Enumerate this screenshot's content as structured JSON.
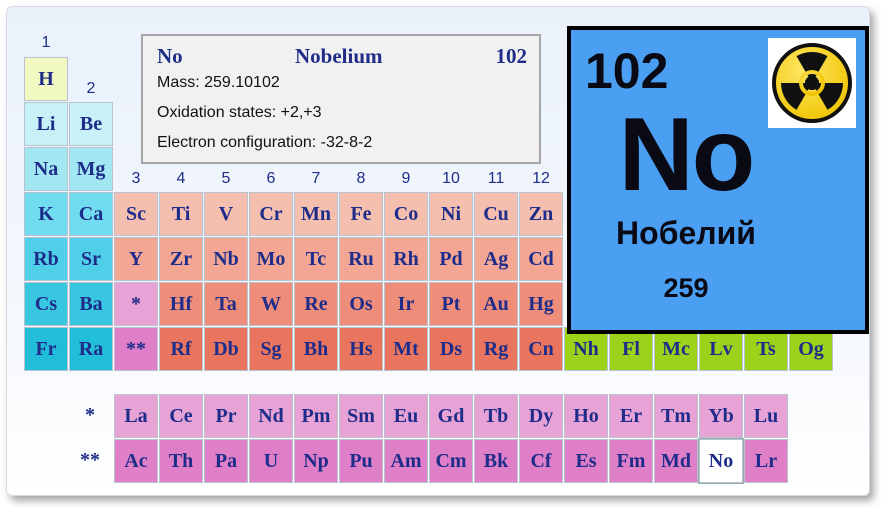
{
  "group_numbers": [
    "1",
    "2",
    "3",
    "4",
    "5",
    "6",
    "7",
    "8",
    "9",
    "10",
    "11",
    "12"
  ],
  "periodic_table": [
    {
      "symbol": "H",
      "row": 0,
      "col": 0,
      "color": "#f1f8c0"
    },
    {
      "symbol": "Li",
      "row": 1,
      "col": 0,
      "color": "#c8f1f7"
    },
    {
      "symbol": "Be",
      "row": 1,
      "col": 1,
      "color": "#c8f1f7"
    },
    {
      "symbol": "Na",
      "row": 2,
      "col": 0,
      "color": "#a3e7f3"
    },
    {
      "symbol": "Mg",
      "row": 2,
      "col": 1,
      "color": "#a3e7f3"
    },
    {
      "symbol": "K",
      "row": 3,
      "col": 0,
      "color": "#71dcef"
    },
    {
      "symbol": "Ca",
      "row": 3,
      "col": 1,
      "color": "#71dcef"
    },
    {
      "symbol": "Sc",
      "row": 3,
      "col": 2,
      "color": "#f5bfb0"
    },
    {
      "symbol": "Ti",
      "row": 3,
      "col": 3,
      "color": "#f5bfb0"
    },
    {
      "symbol": "V",
      "row": 3,
      "col": 4,
      "color": "#f5bfb0"
    },
    {
      "symbol": "Cr",
      "row": 3,
      "col": 5,
      "color": "#f5bfb0"
    },
    {
      "symbol": "Mn",
      "row": 3,
      "col": 6,
      "color": "#f5bfb0"
    },
    {
      "symbol": "Fe",
      "row": 3,
      "col": 7,
      "color": "#f5bfb0"
    },
    {
      "symbol": "Co",
      "row": 3,
      "col": 8,
      "color": "#f5bfb0"
    },
    {
      "symbol": "Ni",
      "row": 3,
      "col": 9,
      "color": "#f5bfb0"
    },
    {
      "symbol": "Cu",
      "row": 3,
      "col": 10,
      "color": "#f5bfb0"
    },
    {
      "symbol": "Zn",
      "row": 3,
      "col": 11,
      "color": "#f5bfb0"
    },
    {
      "symbol": "Rb",
      "row": 4,
      "col": 0,
      "color": "#4fd0e8"
    },
    {
      "symbol": "Sr",
      "row": 4,
      "col": 1,
      "color": "#4fd0e8"
    },
    {
      "symbol": "Y",
      "row": 4,
      "col": 2,
      "color": "#f2a693"
    },
    {
      "symbol": "Zr",
      "row": 4,
      "col": 3,
      "color": "#f2a693"
    },
    {
      "symbol": "Nb",
      "row": 4,
      "col": 4,
      "color": "#f2a693"
    },
    {
      "symbol": "Mo",
      "row": 4,
      "col": 5,
      "color": "#f2a693"
    },
    {
      "symbol": "Tc",
      "row": 4,
      "col": 6,
      "color": "#f2a693"
    },
    {
      "symbol": "Ru",
      "row": 4,
      "col": 7,
      "color": "#f2a693"
    },
    {
      "symbol": "Rh",
      "row": 4,
      "col": 8,
      "color": "#f2a693"
    },
    {
      "symbol": "Pd",
      "row": 4,
      "col": 9,
      "color": "#f2a693"
    },
    {
      "symbol": "Ag",
      "row": 4,
      "col": 10,
      "color": "#f2a693"
    },
    {
      "symbol": "Cd",
      "row": 4,
      "col": 11,
      "color": "#f2a693"
    },
    {
      "symbol": "Cs",
      "row": 5,
      "col": 0,
      "color": "#38c6e0"
    },
    {
      "symbol": "Ba",
      "row": 5,
      "col": 1,
      "color": "#38c6e0"
    },
    {
      "symbol": "*",
      "row": 5,
      "col": 2,
      "color": "#e8a3d6"
    },
    {
      "symbol": "Hf",
      "row": 5,
      "col": 3,
      "color": "#ee8d79"
    },
    {
      "symbol": "Ta",
      "row": 5,
      "col": 4,
      "color": "#ee8d79"
    },
    {
      "symbol": "W",
      "row": 5,
      "col": 5,
      "color": "#ee8d79"
    },
    {
      "symbol": "Re",
      "row": 5,
      "col": 6,
      "color": "#ee8d79"
    },
    {
      "symbol": "Os",
      "row": 5,
      "col": 7,
      "color": "#ee8d79"
    },
    {
      "symbol": "Ir",
      "row": 5,
      "col": 8,
      "color": "#ee8d79"
    },
    {
      "symbol": "Pt",
      "row": 5,
      "col": 9,
      "color": "#ee8d79"
    },
    {
      "symbol": "Au",
      "row": 5,
      "col": 10,
      "color": "#ee8d79"
    },
    {
      "symbol": "Hg",
      "row": 5,
      "col": 11,
      "color": "#ee8d79"
    },
    {
      "symbol": "Fr",
      "row": 6,
      "col": 0,
      "color": "#22bdd9"
    },
    {
      "symbol": "Ra",
      "row": 6,
      "col": 1,
      "color": "#22bdd9"
    },
    {
      "symbol": "**",
      "row": 6,
      "col": 2,
      "color": "#df7fc7"
    },
    {
      "symbol": "Rf",
      "row": 6,
      "col": 3,
      "color": "#e9755f"
    },
    {
      "symbol": "Db",
      "row": 6,
      "col": 4,
      "color": "#e9755f"
    },
    {
      "symbol": "Sg",
      "row": 6,
      "col": 5,
      "color": "#e9755f"
    },
    {
      "symbol": "Bh",
      "row": 6,
      "col": 6,
      "color": "#e9755f"
    },
    {
      "symbol": "Hs",
      "row": 6,
      "col": 7,
      "color": "#e9755f"
    },
    {
      "symbol": "Mt",
      "row": 6,
      "col": 8,
      "color": "#e9755f"
    },
    {
      "symbol": "Ds",
      "row": 6,
      "col": 9,
      "color": "#e9755f"
    },
    {
      "symbol": "Rg",
      "row": 6,
      "col": 10,
      "color": "#e9755f"
    },
    {
      "symbol": "Cn",
      "row": 6,
      "col": 11,
      "color": "#e9755f"
    },
    {
      "symbol": "Nh",
      "row": 6,
      "col": 12,
      "color": "#9bd21a"
    },
    {
      "symbol": "Fl",
      "row": 6,
      "col": 13,
      "color": "#9bd21a"
    },
    {
      "symbol": "Mc",
      "row": 6,
      "col": 14,
      "color": "#9bd21a"
    },
    {
      "symbol": "Lv",
      "row": 6,
      "col": 15,
      "color": "#9bd21a"
    },
    {
      "symbol": "Ts",
      "row": 6,
      "col": 16,
      "color": "#9bd21a"
    },
    {
      "symbol": "Og",
      "row": 6,
      "col": 17,
      "color": "#9bd21a"
    }
  ],
  "lanthanide_marker": "*",
  "actinide_marker": "**",
  "lanthanides": [
    "La",
    "Ce",
    "Pr",
    "Nd",
    "Pm",
    "Sm",
    "Eu",
    "Gd",
    "Tb",
    "Dy",
    "Ho",
    "Er",
    "Tm",
    "Yb",
    "Lu"
  ],
  "actinides": [
    "Ac",
    "Th",
    "Pa",
    "U",
    "Np",
    "Pu",
    "Am",
    "Cm",
    "Bk",
    "Cf",
    "Es",
    "Fm",
    "Md",
    "No",
    "Lr"
  ],
  "lanthanide_color": "#e8a3d6",
  "actinide_color": "#df7fc7",
  "selected_symbol": "No",
  "info": {
    "symbol": "No",
    "name": "Nobelium",
    "number": "102",
    "mass_line": "Mass: 259.10102",
    "oxidation_line": "Oxidation states: +2,+3",
    "config_line": "Electron configuration: -32-8-2"
  },
  "tile": {
    "number": "102",
    "symbol": "No",
    "russian_name": "Нобелий",
    "mass": "259",
    "background": "#4a9ff2",
    "radiation_icon": "radiation-hazard-icon"
  }
}
